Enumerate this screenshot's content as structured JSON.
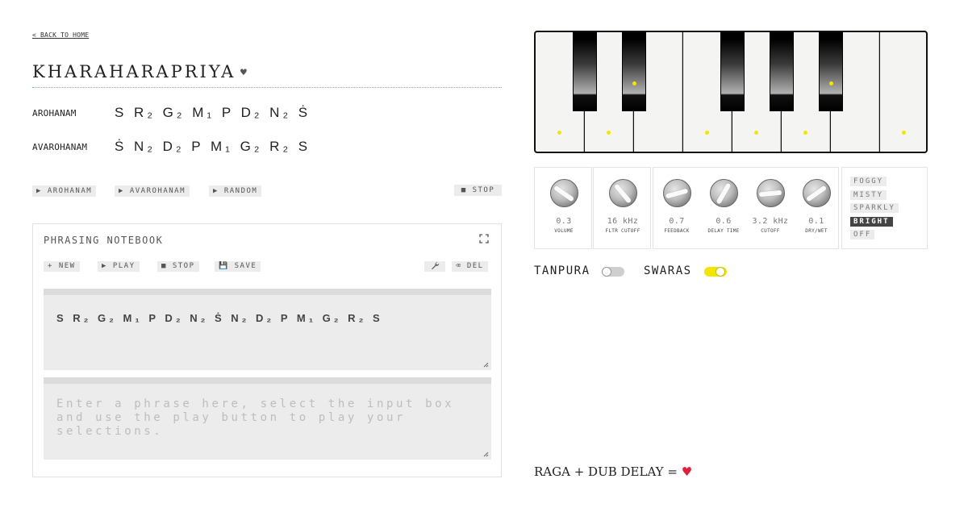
{
  "nav": {
    "back_label": "< BACK TO HOME"
  },
  "raga": {
    "title": "KHARAHARAPRIYA",
    "favorite_icon": "heart-icon",
    "arohanam_label": "AROHANAM",
    "arohanam_notes": "S R₂ G₂ M₁ P D₂ N₂ Ṡ",
    "avarohanam_label": "AVAROHANAM",
    "avarohanam_notes": "Ṡ N₂ D₂ P M₁ G₂ R₂ S"
  },
  "playback": {
    "arohanam": "▶ AROHANAM",
    "avarohanam": "▶ AVAROHANAM",
    "random": "▶ RANDOM",
    "stop": "■  STOP"
  },
  "notebook": {
    "title": "PHRASING NOTEBOOK",
    "expand_icon": "expand-icon",
    "new_label": "+ NEW",
    "play_label": "▶ PLAY",
    "stop_label": "■ STOP",
    "save_label": "💾 SAVE",
    "tools_icon": "wrench-icon",
    "delete_label": "⌫ DEL",
    "phrase_1": "S R₂ G₂ M₁ P D₂ N₂ Ṡ N₂ D₂ P M₁ G₂ R₂ S",
    "phrase_2_placeholder": "Enter a phrase here, select the input box and use the play button to play your selections."
  },
  "synth": {
    "volume": {
      "value": "0.3",
      "label": "VOLUME"
    },
    "filter_cutoff": {
      "value": "16 kHz",
      "label": "FLTR CUTOFF"
    },
    "feedback": {
      "value": "0.7",
      "label": "FEEDBACK"
    },
    "delay_time": {
      "value": "0.6",
      "label": "DELAY TIME"
    },
    "cutoff": {
      "value": "3.2 kHz",
      "label": "CUTOFF"
    },
    "dry_wet": {
      "value": "0.1",
      "label": "DRY/WET"
    }
  },
  "presets": {
    "items": [
      "FOGGY",
      "MISTY",
      "SPARKLY",
      "BRIGHT",
      "OFF"
    ],
    "selected": "BRIGHT"
  },
  "toggles": {
    "tanpura": {
      "label": "TANPURA",
      "on": false
    },
    "swaras": {
      "label": "SWARAS",
      "on": true
    }
  },
  "footer": {
    "tagline": "RAGA + DUB DELAY = ",
    "heart": "♥"
  },
  "colors": {
    "accent_yellow": "#f2e600",
    "heart_red": "#e0203a",
    "rule_green": "#6bbf6b"
  }
}
